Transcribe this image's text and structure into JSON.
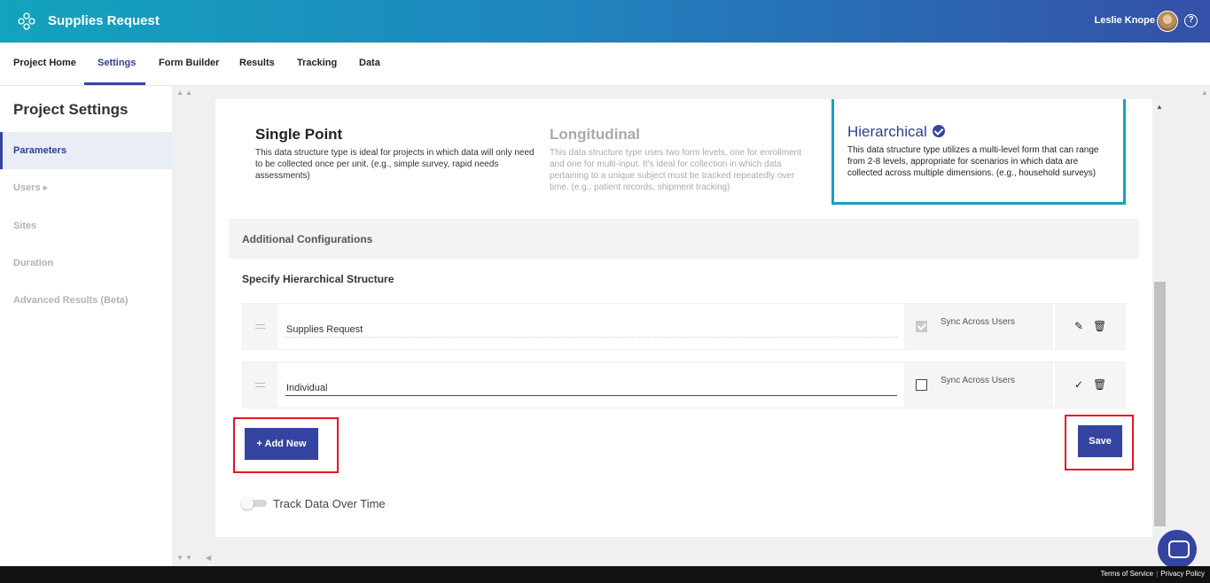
{
  "header": {
    "app_title": "Supplies Request",
    "user_name": "Leslie Knope",
    "help": "?"
  },
  "nav": {
    "tabs": [
      "Project Home",
      "Settings",
      "Form Builder",
      "Results",
      "Tracking",
      "Data"
    ],
    "active": "Settings"
  },
  "sidebar": {
    "title": "Project Settings",
    "items": [
      {
        "label": "Parameters"
      },
      {
        "label": "Users ▸"
      },
      {
        "label": "Sites"
      },
      {
        "label": "Duration"
      },
      {
        "label": "Advanced Results (Beta)"
      }
    ]
  },
  "structure_options": [
    {
      "title": "Single Point",
      "description": "This data structure type is ideal for projects in which data will only need to be collected once per unit. (e.g., simple survey, rapid needs assessments)"
    },
    {
      "title": "Longitudinal",
      "description": "This data structure type uses two form levels, one for enrollment and one for multi-input. It's ideal for collection in which data pertaining to a unique subject must be tracked repeatedly over time. (e.g., patient records, shipment tracking)"
    },
    {
      "title": "Hierarchical",
      "description": "This data structure type utilizes a multi-level form that can range from 2-8 levels, appropriate for scenarios in which data are collected across multiple dimensions. (e.g., household surveys)"
    }
  ],
  "additional_configurations": "Additional Configurations",
  "specify_title": "Specify Hierarchical Structure",
  "levels": [
    {
      "value": "Supplies Request",
      "sync_label": "Sync Across Users",
      "sync_checked": true
    },
    {
      "value": "Individual",
      "sync_label": "Sync Across Users",
      "sync_checked": false
    }
  ],
  "buttons": {
    "add_new": "+ Add New",
    "save": "Save"
  },
  "toggle_label": "Track Data Over Time",
  "footer": {
    "terms": "Terms of Service",
    "privacy": "Privacy Policy"
  },
  "colors": {
    "accent": "#3444a0",
    "teal": "#1aa0b8",
    "highlight": "#e8141d"
  }
}
